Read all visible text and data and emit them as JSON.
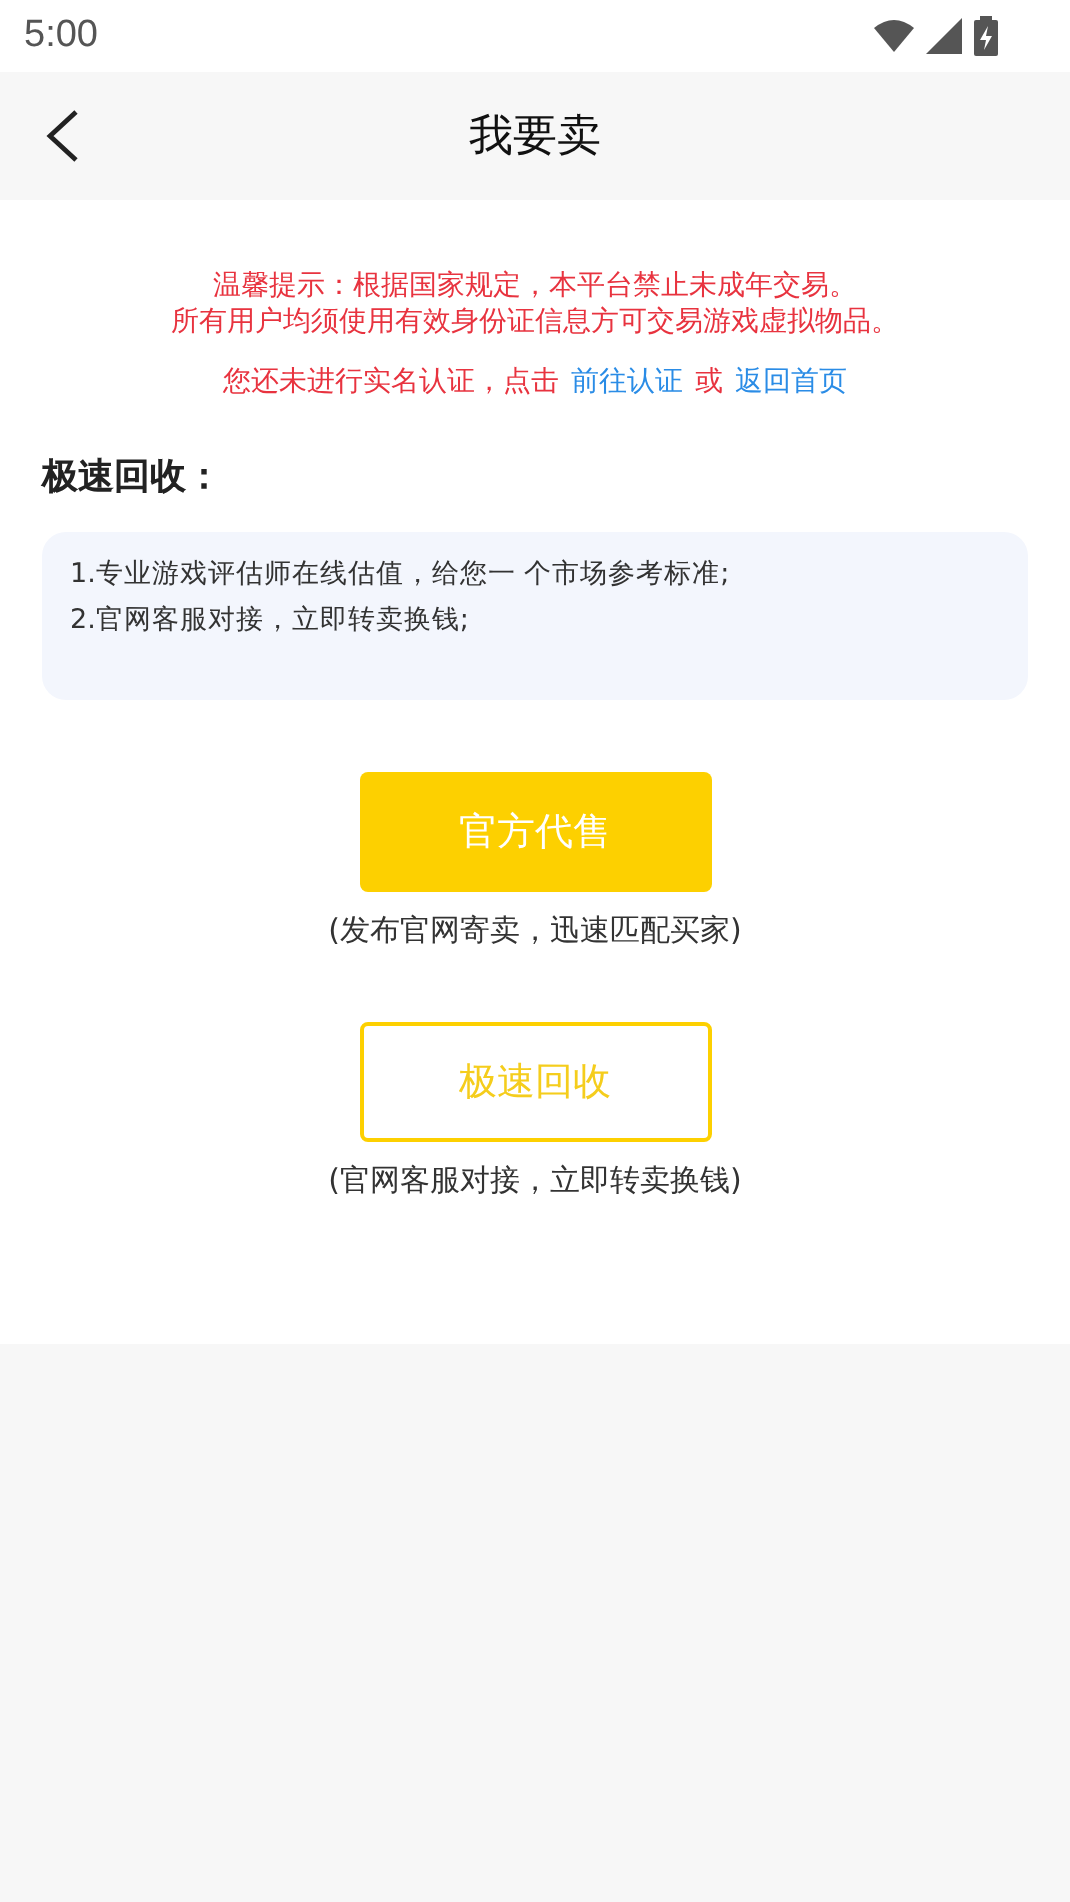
{
  "status_bar": {
    "time": "5:00"
  },
  "nav_bar": {
    "title": "我要卖"
  },
  "notice": {
    "lines": [
      "温馨提示：根据国家规定，本平台禁止未成年交易。",
      "所有用户均须使用有效身份证信息方可交易游戏虚拟物品。"
    ],
    "verify": {
      "text": "您还未进行实名认证，点击",
      "link_1": "前往认证",
      "joiner": "或",
      "link_2": "返回首页"
    }
  },
  "section": {
    "title": "极速回收：",
    "items": [
      "1.专业游戏评估师在线估值，给您一 个市场参考标准;",
      "2.官网客服对接，立即转卖换钱;"
    ]
  },
  "actions": [
    {
      "kind": "filled",
      "label": "官方代售",
      "caption": "(发布官网寄卖，迅速匹配买家)"
    },
    {
      "kind": "outline",
      "label": "极速回收",
      "caption": "(官网客服对接，立即转卖换钱)"
    }
  ]
}
